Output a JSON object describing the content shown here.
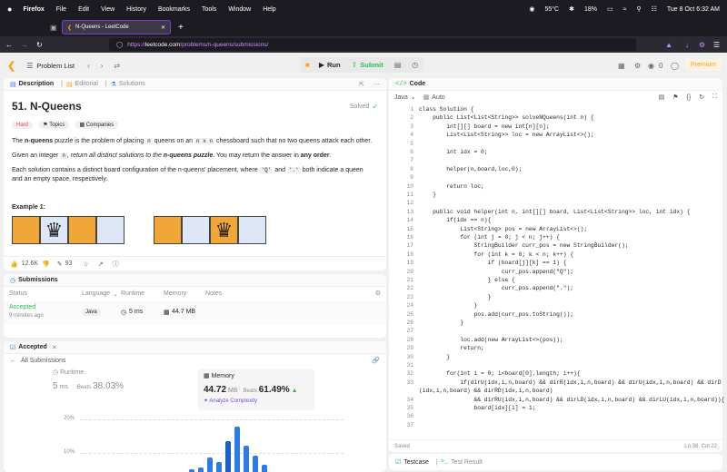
{
  "menubar": {
    "apple": "",
    "items": [
      "Firefox",
      "File",
      "Edit",
      "View",
      "History",
      "Bookmarks",
      "Tools",
      "Window",
      "Help"
    ],
    "temp": "55°C",
    "battery": "18%",
    "datetime": "Tue 8 Oct 6:32 AM"
  },
  "browser": {
    "tab_title": "N-Queens - LeetCode",
    "url_prefix": "https://",
    "url_host": "leetcode.com",
    "url_path": "/problems/n-queens/submissions/"
  },
  "toolbar": {
    "problem_list": "Problem List",
    "run": "Run",
    "submit": "Submit",
    "counter": "0",
    "premium": "Premium"
  },
  "desc_tabs": {
    "description": "Description",
    "editorial": "Editorial",
    "solutions": "Solutions"
  },
  "problem": {
    "title": "51. N-Queens",
    "status": "Solved",
    "difficulty": "Hard",
    "topics": "Topics",
    "companies": "Companies",
    "p1_a": "The ",
    "p1_b": "n-queens",
    "p1_c": " puzzle is the problem of placing ",
    "p1_d": "n",
    "p1_e": " queens on an ",
    "p1_f": "n x n",
    "p1_g": " chessboard such that no two queens attack each other.",
    "p2_a": "Given an integer ",
    "p2_b": "n",
    "p2_c": ", return all distinct solutions to the ",
    "p2_d": "n-queens puzzle",
    "p2_e": ". You may return the answer in ",
    "p2_f": "any order",
    "p2_g": ".",
    "p3_a": "Each solution contains a distinct board configuration of the n-queens' placement, where ",
    "p3_b": "'Q'",
    "p3_c": " and ",
    "p3_d": "'.'",
    "p3_e": " both indicate a queen and an empty space, respectively.",
    "example": "Example 1:",
    "likes": "12.6K",
    "comments": "93"
  },
  "submissions": {
    "header": "Submissions",
    "cols": [
      "Status",
      "Language",
      "Runtime",
      "Memory",
      "Notes"
    ],
    "row": {
      "status": "Accepted",
      "time": "9 minutes ago",
      "lang": "Java",
      "runtime": "5 ms",
      "memory": "44.7 MB"
    }
  },
  "accepted": {
    "header": "Accepted",
    "all": "All Submissions",
    "runtime_label": "Runtime",
    "runtime_val": "5",
    "runtime_unit": "ms",
    "runtime_beats_label": "Beats",
    "runtime_beats": "38.03%",
    "memory_label": "Memory",
    "memory_val": "44.72",
    "memory_unit": "MB",
    "memory_beats_label": "Beats",
    "memory_beats": "61.49%",
    "analyze": "Analyze Complexity",
    "y1": "20%",
    "y2": "10%"
  },
  "chart_data": {
    "type": "bar",
    "y_ticks": [
      "20%",
      "10%"
    ],
    "values": [
      1,
      2,
      6,
      4,
      13,
      19,
      11,
      7,
      3
    ],
    "highlight_index": 4
  },
  "code_panel": {
    "title": "Code",
    "lang": "Java",
    "auto": "Auto",
    "saved": "Saved",
    "pos": "Ln 38, Col 22"
  },
  "code_lines": [
    "class Solution {",
    "    public List<List<String>> solveNQueens(int n) {",
    "        int[][] board = new int[n][n];",
    "        List<List<String>> loc = new ArrayList<>();",
    "",
    "        int idx = 0;",
    "",
    "        helper(n,board,loc,0);",
    "",
    "        return loc;",
    "    }",
    "",
    "    public void helper(int n, int[][] board, List<List<String>> loc, int idx) {",
    "        if(idx == n){",
    "            List<String> pos = new ArrayList<>();",
    "            for (int j = 0; j < n; j++) {",
    "                StringBuilder curr_pos = new StringBuilder();",
    "                for (int k = 0; k < n; k++) {",
    "                    if (board[j][k] == 1) {",
    "                        curr_pos.append(\"Q\");",
    "                    } else {",
    "                        curr_pos.append(\".\");",
    "                    }",
    "                }",
    "                pos.add(curr_pos.toString());",
    "            }",
    "",
    "            loc.add(new ArrayList<>(pos));",
    "            return;",
    "        }",
    "",
    "        for(int i = 0; i<board[0].length; i++){",
    "            if(dirU(idx,i,n,board) && dirR(idx,i,n,board) && dirU(idx,i,n,board) && dirD",
    "(idx,i,n,board) && dirRD(idx,i,n,board)",
    "                && dirRU(idx,i,n,board) && dirLD(idx,i,n,board) && dirLU(idx,i,n,board)){",
    "                board[idx][i] = 1;",
    "",
    ""
  ],
  "line_numbers": [
    "1",
    "2",
    "3",
    "4",
    "5",
    "6",
    "7",
    "8",
    "9",
    "10",
    "11",
    "12",
    "13",
    "14",
    "15",
    "16",
    "17",
    "18",
    "19",
    "20",
    "21",
    "22",
    "23",
    "24",
    "25",
    "26",
    "27",
    "28",
    "29",
    "30",
    "31",
    "32",
    "33",
    "",
    "34",
    "35",
    "36",
    "37"
  ],
  "bottom": {
    "testcase": "Testcase",
    "result": "Test Result"
  }
}
